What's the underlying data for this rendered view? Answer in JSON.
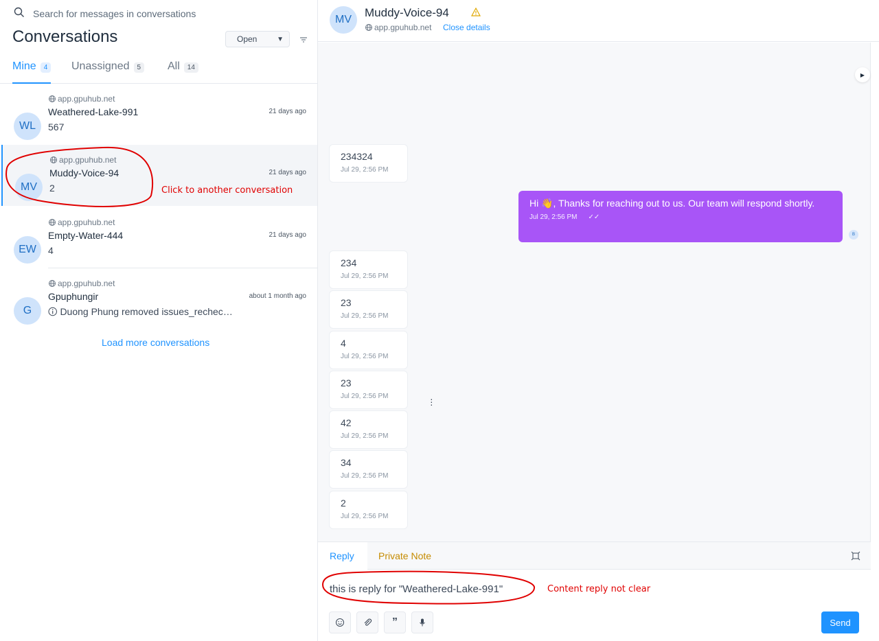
{
  "search": {
    "placeholder": "Search for messages in conversations"
  },
  "list_title": "Conversations",
  "status_filter": {
    "selected": "Open"
  },
  "tabs": [
    {
      "label": "Mine",
      "count": "4"
    },
    {
      "label": "Unassigned",
      "count": "5"
    },
    {
      "label": "All",
      "count": "14"
    }
  ],
  "conversations": [
    {
      "initials": "WL",
      "inbox": "app.gpuhub.net",
      "name": "Weathered-Lake-991",
      "time": "21 days ago",
      "message": "567"
    },
    {
      "initials": "MV",
      "inbox": "app.gpuhub.net",
      "name": "Muddy-Voice-94",
      "time": "21 days ago",
      "message": "2"
    },
    {
      "initials": "EW",
      "inbox": "app.gpuhub.net",
      "name": "Empty-Water-444",
      "time": "21 days ago",
      "message": "4"
    },
    {
      "initials": "G",
      "inbox": "app.gpuhub.net",
      "name": "Gpuphungir",
      "time": "about 1 month ago",
      "message": "Duong Phung removed issues_rechecking"
    }
  ],
  "load_more": "Load more conversations",
  "header": {
    "initials": "MV",
    "name": "Muddy-Voice-94",
    "inbox": "app.gpuhub.net",
    "close_details": "Close details"
  },
  "messages": [
    {
      "text": "234324",
      "time": "Jul 29, 2:56 PM"
    },
    {
      "text": "234",
      "time": "Jul 29, 2:56 PM"
    },
    {
      "text": "23",
      "time": "Jul 29, 2:56 PM"
    },
    {
      "text": "4",
      "time": "Jul 29, 2:56 PM"
    },
    {
      "text": "23",
      "time": "Jul 29, 2:56 PM"
    },
    {
      "text": "42",
      "time": "Jul 29, 2:56 PM"
    },
    {
      "text": "34",
      "time": "Jul 29, 2:56 PM"
    },
    {
      "text": "2",
      "time": "Jul 29, 2:56 PM"
    }
  ],
  "outgoing": {
    "text": "Hi 👋, Thanks for reaching out to us. Our team will respond shortly.",
    "time": "Jul 29, 2:56 PM",
    "agent": "B"
  },
  "reply": {
    "tab_reply": "Reply",
    "tab_note": "Private Note",
    "draft": "this is reply for \"Weathered-Lake-991\"",
    "send": "Send"
  },
  "annotations": {
    "click_note": "Click to another conversation",
    "content_note": "Content reply not clear"
  },
  "colors": {
    "accent": "#1f93ff",
    "outgoing_bubble": "#a855f7",
    "annotation": "#e00000"
  }
}
